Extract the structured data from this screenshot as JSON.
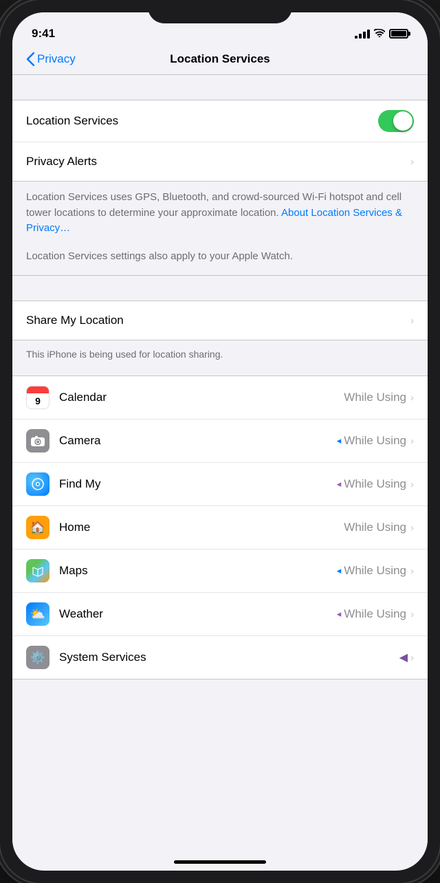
{
  "statusBar": {
    "time": "9:41"
  },
  "nav": {
    "backLabel": "Privacy",
    "title": "Location Services"
  },
  "sections": {
    "locationServicesToggle": {
      "label": "Location Services",
      "enabled": true
    },
    "privacyAlerts": {
      "label": "Privacy Alerts"
    },
    "description": {
      "text1": "Location Services uses GPS, Bluetooth, and crowd-sourced Wi-Fi hotspot and cell tower locations to determine your approximate location.",
      "linkText": "About Location Services & Privacy…",
      "text2": "Location Services settings also apply to your Apple Watch."
    },
    "shareMyLocation": {
      "label": "Share My Location",
      "footer": "This iPhone is being used for location sharing."
    },
    "apps": [
      {
        "name": "Calendar",
        "icon": "calendar",
        "value": "While Using",
        "arrow": false
      },
      {
        "name": "Camera",
        "icon": "camera",
        "value": "While Using",
        "arrow": "blue"
      },
      {
        "name": "Find My",
        "icon": "findmy",
        "value": "While Using",
        "arrow": "purple"
      },
      {
        "name": "Home",
        "icon": "home",
        "value": "While Using",
        "arrow": false
      },
      {
        "name": "Maps",
        "icon": "maps",
        "value": "While Using",
        "arrow": "blue"
      },
      {
        "name": "Weather",
        "icon": "weather",
        "value": "While Using",
        "arrow": "purple"
      },
      {
        "name": "System Services",
        "icon": "system",
        "value": "",
        "arrow": "solid-purple"
      }
    ]
  }
}
